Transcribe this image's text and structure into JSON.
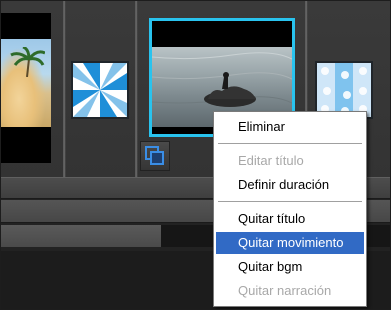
{
  "context_menu": {
    "items": [
      {
        "label": "Eliminar",
        "enabled": true
      },
      {
        "label": "Editar título",
        "enabled": false
      },
      {
        "label": "Definir duración",
        "enabled": true
      },
      {
        "label": "Quitar título",
        "enabled": true
      },
      {
        "label": "Quitar movimiento",
        "enabled": true,
        "highlighted": true
      },
      {
        "label": "Quitar bgm",
        "enabled": true
      },
      {
        "label": "Quitar narración",
        "enabled": false
      }
    ],
    "highlight_color": "#316ac5"
  },
  "storyboard": {
    "selected_clip_border_color": "#29c3ee",
    "transition_colors": [
      "#1f8fd8",
      "#ffffff"
    ],
    "clip_options_icon": "overlapping-squares-icon"
  }
}
